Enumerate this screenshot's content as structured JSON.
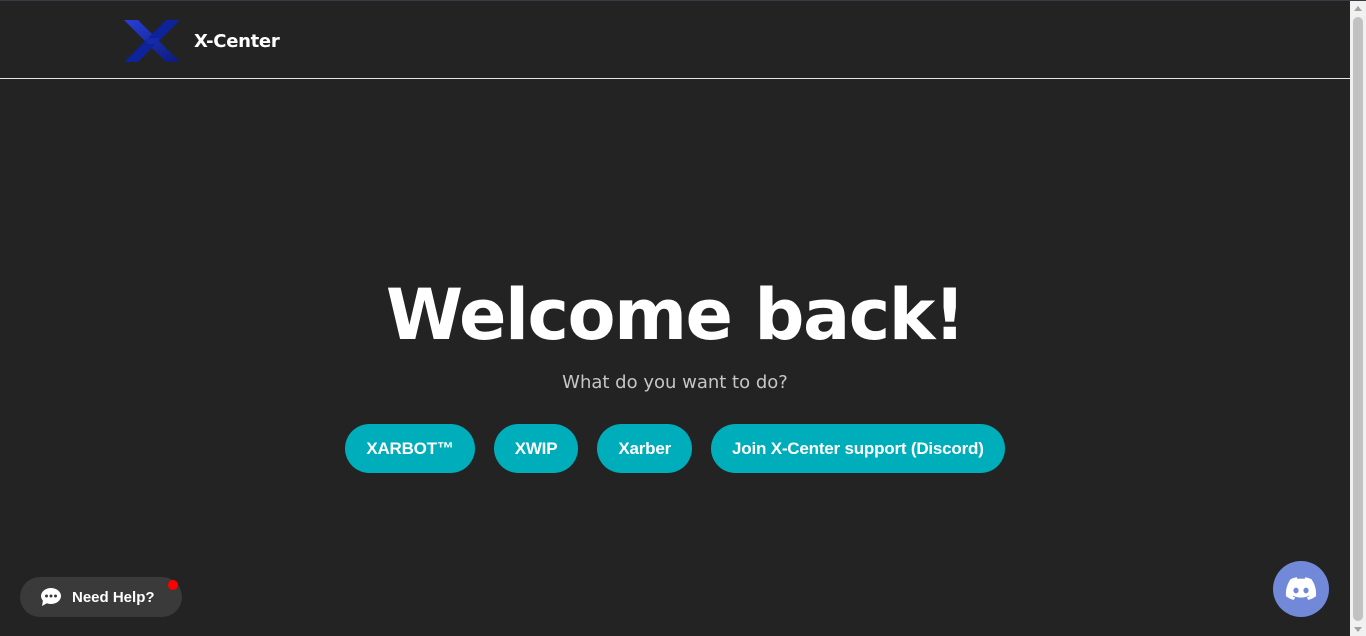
{
  "navbar": {
    "brand_name": "X-Center",
    "logo_icon": "x-logo-icon"
  },
  "hero": {
    "title": "Welcome back!",
    "subtitle": "What do you want to do?"
  },
  "actions": {
    "buttons": [
      {
        "label": "XARBOT™"
      },
      {
        "label": "XWIP"
      },
      {
        "label": "Xarber"
      },
      {
        "label": "Join X-Center support (Discord)"
      }
    ]
  },
  "help_widget": {
    "label": "Need Help?",
    "icon": "chat-bubble-icon",
    "notification": "red-dot"
  },
  "discord_widget": {
    "icon": "discord-icon"
  },
  "colors": {
    "background": "#232323",
    "accent": "#00adbb",
    "discord": "#7289da",
    "notification": "#ff0000"
  }
}
